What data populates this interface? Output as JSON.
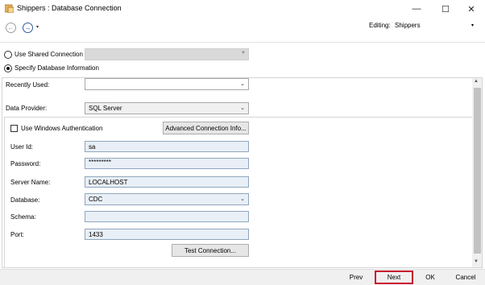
{
  "window": {
    "title": "Shippers : Database Connection",
    "minimize_glyph": "—",
    "maximize_glyph": "☐",
    "close_glyph": "✕"
  },
  "toolbar": {
    "back_glyph": "←",
    "forward_glyph": "→",
    "dropdown_glyph": "▾",
    "editing_label": "Editing:",
    "editing_value": "Shippers"
  },
  "connection_mode": {
    "shared_label": "Use Shared Connection",
    "specify_label": "Specify Database Information",
    "selected": "specify"
  },
  "form": {
    "recently_used_label": "Recently Used:",
    "recently_used_value": "",
    "data_provider_label": "Data Provider:",
    "data_provider_value": "SQL Server",
    "windows_auth_label": "Use Windows Authentication",
    "windows_auth_checked": false,
    "advanced_button": "Advanced Connection Info...",
    "user_id_label": "User Id:",
    "user_id_value": "sa",
    "password_label": "Password:",
    "password_value": "*********",
    "server_name_label": "Server Name:",
    "server_name_value": "LOCALHOST",
    "database_label": "Database:",
    "database_value": "CDC",
    "schema_label": "Schema:",
    "schema_value": "",
    "port_label": "Port:",
    "port_value": "1433",
    "test_button": "Test Connection..."
  },
  "footer": {
    "prev_label": "Prev",
    "next_label": "Next",
    "ok_label": "OK",
    "cancel_label": "Cancel",
    "highlight_color": "#c8102e"
  }
}
